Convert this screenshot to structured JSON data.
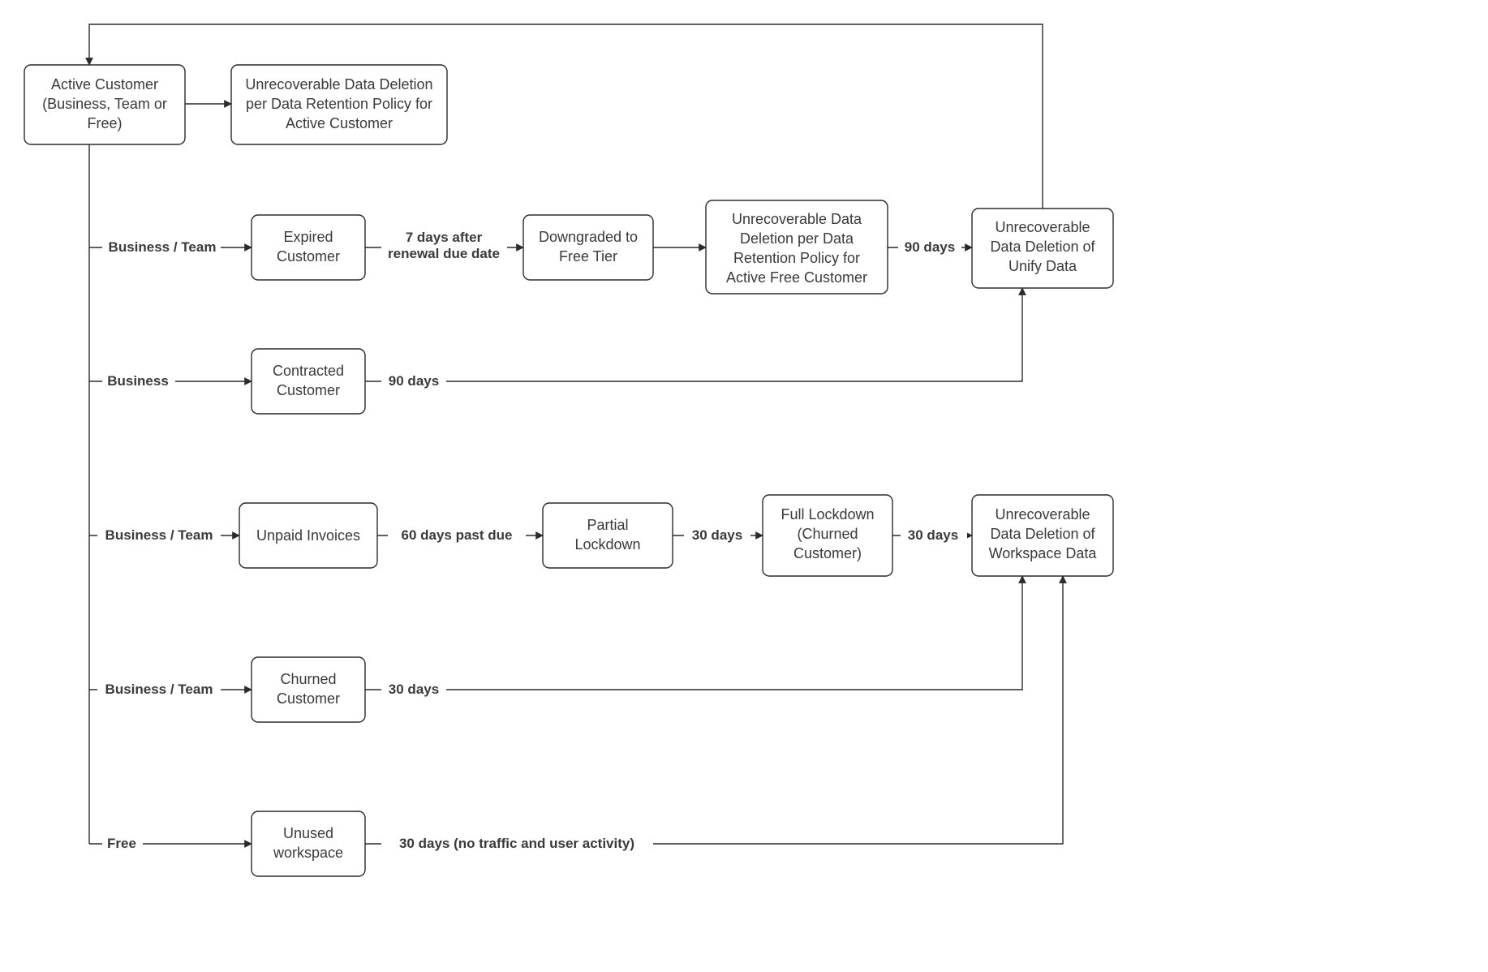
{
  "nodes": {
    "active_customer": {
      "line1": "Active Customer",
      "line2": "(Business, Team or",
      "line3": "Free)"
    },
    "unrec_active": {
      "line1": "Unrecoverable Data Deletion",
      "line2": "per Data Retention Policy for",
      "line3": "Active Customer"
    },
    "expired": {
      "line1": "Expired",
      "line2": "Customer"
    },
    "downgraded": {
      "line1": "Downgraded to",
      "line2": "Free Tier"
    },
    "unrec_free": {
      "line1": "Unrecoverable Data",
      "line2": "Deletion per Data",
      "line3": "Retention Policy for",
      "line4": "Active Free Customer"
    },
    "unrec_unify": {
      "line1": "Unrecoverable",
      "line2": "Data Deletion of",
      "line3": "Unify Data"
    },
    "contracted": {
      "line1": "Contracted",
      "line2": "Customer"
    },
    "unpaid": {
      "line1": "Unpaid Invoices"
    },
    "partial_lock": {
      "line1": "Partial",
      "line2": "Lockdown"
    },
    "full_lock": {
      "line1": "Full Lockdown",
      "line2": "(Churned",
      "line3": "Customer)"
    },
    "unrec_ws": {
      "line1": "Unrecoverable",
      "line2": "Data Deletion of",
      "line3": "Workspace Data"
    },
    "churned": {
      "line1": "Churned",
      "line2": "Customer"
    },
    "unused_ws": {
      "line1": "Unused",
      "line2": "workspace"
    }
  },
  "edges": {
    "e_bt_expired": "Business / Team",
    "e_7days": "7 days after",
    "e_7days_b": "renewal due date",
    "e_90": "90 days",
    "e_business": "Business",
    "e_90b": "90 days",
    "e_bt_unpaid": "Business / Team",
    "e_60": "60 days past due",
    "e_30a": "30 days",
    "e_30b": "30 days",
    "e_bt_churned": "Business / Team",
    "e_30c": "30 days",
    "e_free": "Free",
    "e_30d": "30 days (no traffic and user activity)"
  }
}
